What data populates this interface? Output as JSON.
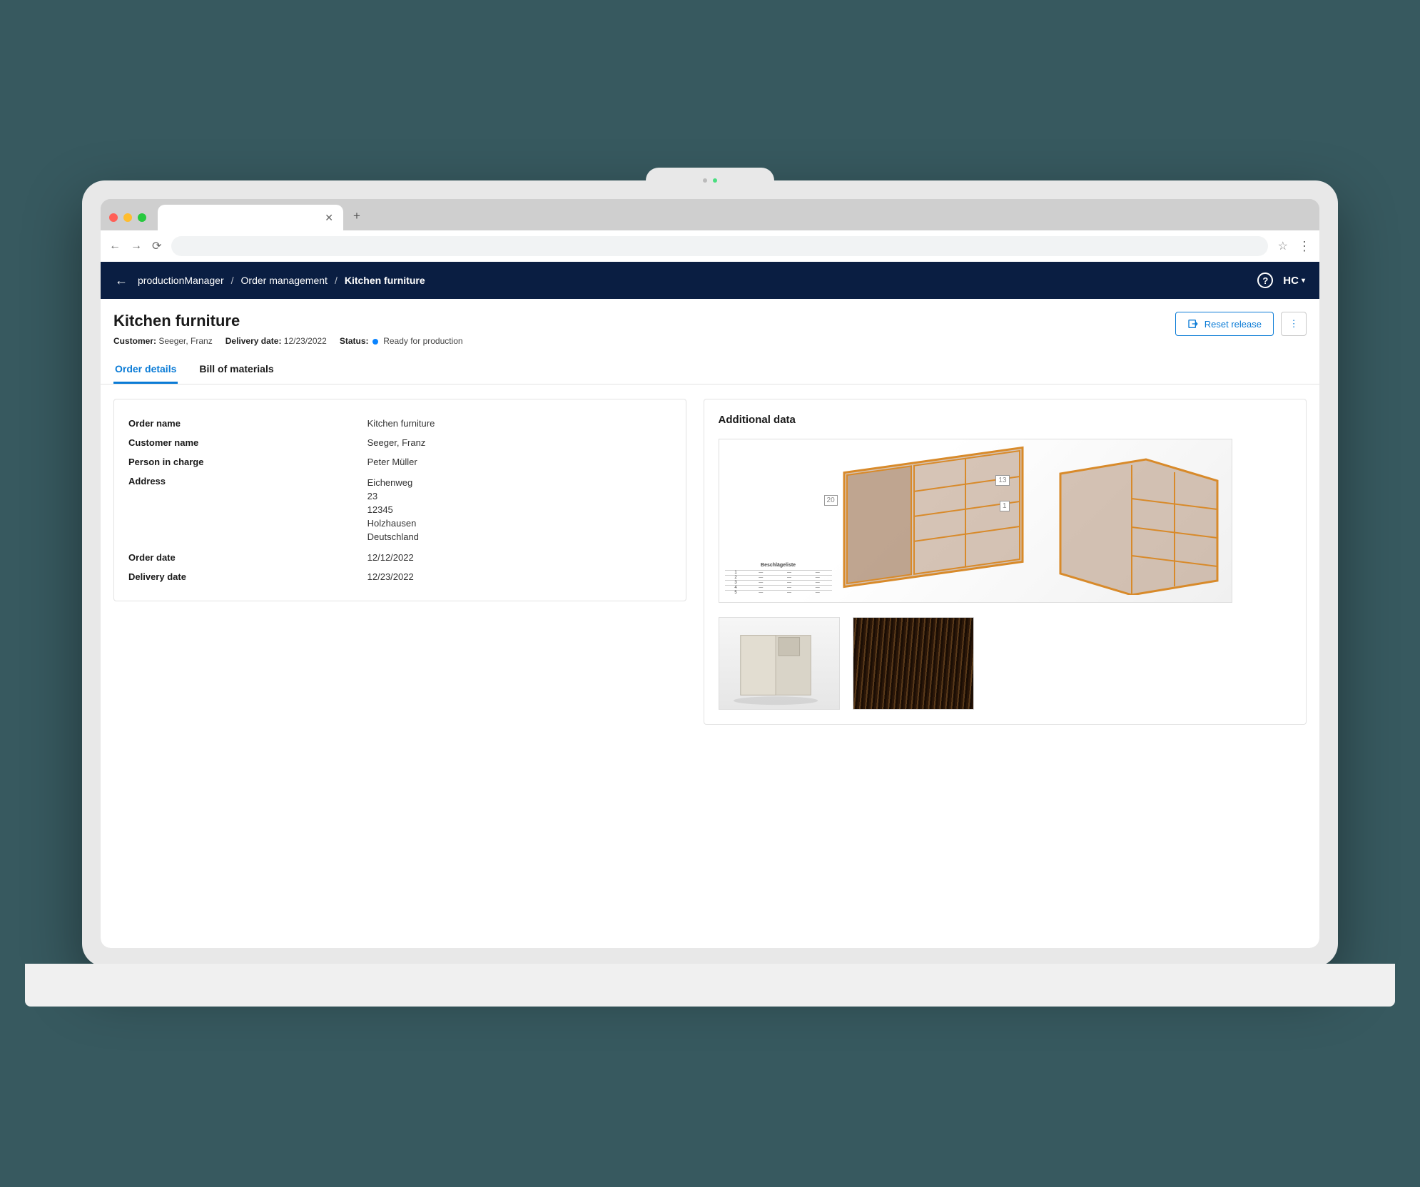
{
  "breadcrumb": {
    "app": "productionManager",
    "section": "Order management",
    "current": "Kitchen furniture"
  },
  "header": {
    "logo_text": "HC"
  },
  "page": {
    "title": "Kitchen furniture",
    "meta": {
      "customer_label": "Customer:",
      "customer_value": "Seeger, Franz",
      "delivery_label": "Delivery date:",
      "delivery_value": "12/23/2022",
      "status_label": "Status:",
      "status_value": "Ready for production"
    },
    "actions": {
      "reset_release": "Reset release"
    }
  },
  "tabs": {
    "order_details": "Order details",
    "bill_of_materials": "Bill of materials"
  },
  "details": {
    "order_name_label": "Order name",
    "order_name_value": "Kitchen furniture",
    "customer_name_label": "Customer name",
    "customer_name_value": "Seeger, Franz",
    "person_label": "Person in charge",
    "person_value": "Peter Müller",
    "address_label": "Address",
    "address_line1": "Eichenweg",
    "address_line2": "23",
    "address_line3": "12345",
    "address_line4": "Holzhausen",
    "address_line5": "Deutschland",
    "order_date_label": "Order date",
    "order_date_value": "12/12/2022",
    "delivery_date_label": "Delivery date",
    "delivery_date_value": "12/23/2022"
  },
  "additional": {
    "title": "Additional data",
    "spec_title": "Beschlägeliste",
    "dim_label_20": "20",
    "dim_label_13": "13",
    "dim_label_1": "1"
  }
}
